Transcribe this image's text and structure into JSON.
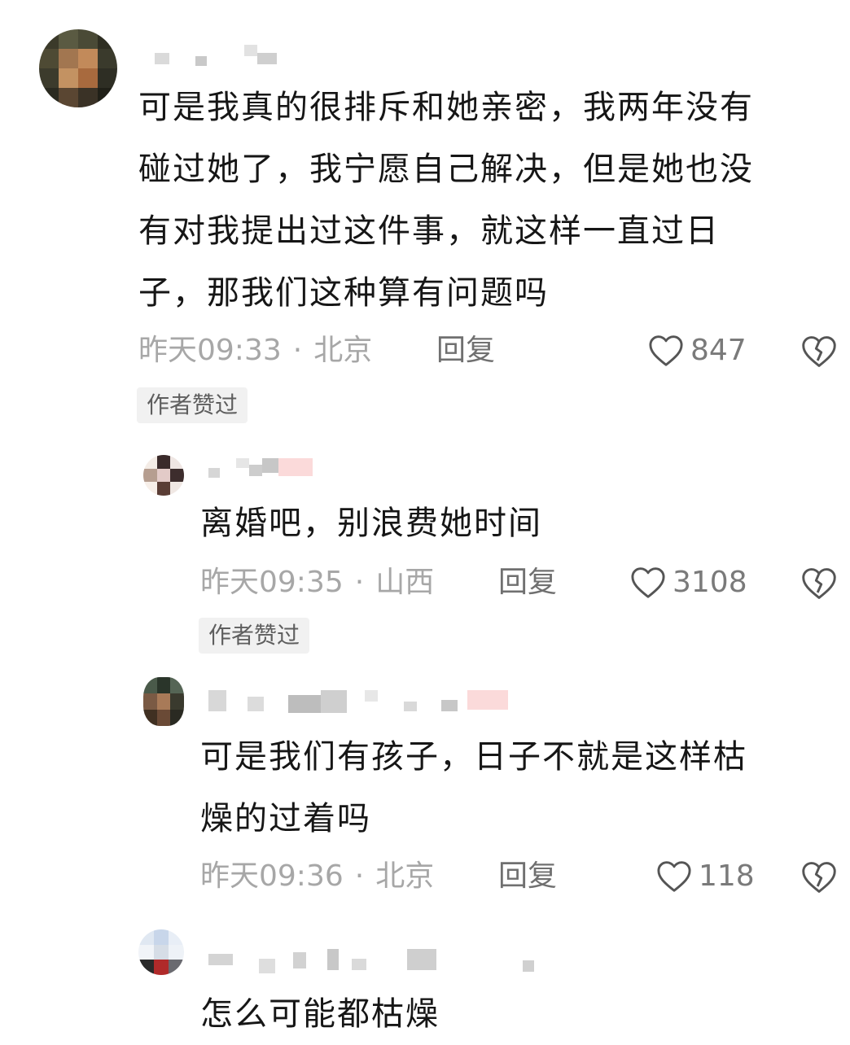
{
  "comments": [
    {
      "content": "可是我真的很排斥和她亲密，我两年没有\n碰过她了，我宁愿自己解决，但是她也没\n有对我提出过这件事，就这样一直过日\n子，那我们这种算有问题吗",
      "time": "昨天09:33",
      "location": "北京",
      "reply": "回复",
      "likes": "847",
      "badge": "作者赞过"
    },
    {
      "content": "离婚吧，别浪费她时间",
      "time": "昨天09:35",
      "location": "山西",
      "reply": "回复",
      "likes": "3108",
      "badge": "作者赞过"
    },
    {
      "content": "可是我们有孩子，日子不就是这样枯\n燥的过着吗",
      "time": "昨天09:36",
      "location": "北京",
      "reply": "回复",
      "likes": "118"
    },
    {
      "content": "怎么可能都枯燥"
    }
  ],
  "meta_separator": "·",
  "icons": {
    "like": "heart-outline-icon",
    "dislike": "broken-heart-icon"
  },
  "colors": {
    "text": "#161616",
    "meta": "#a7a7a7",
    "reply": "#707070",
    "badge_bg": "#f1f1f1"
  }
}
